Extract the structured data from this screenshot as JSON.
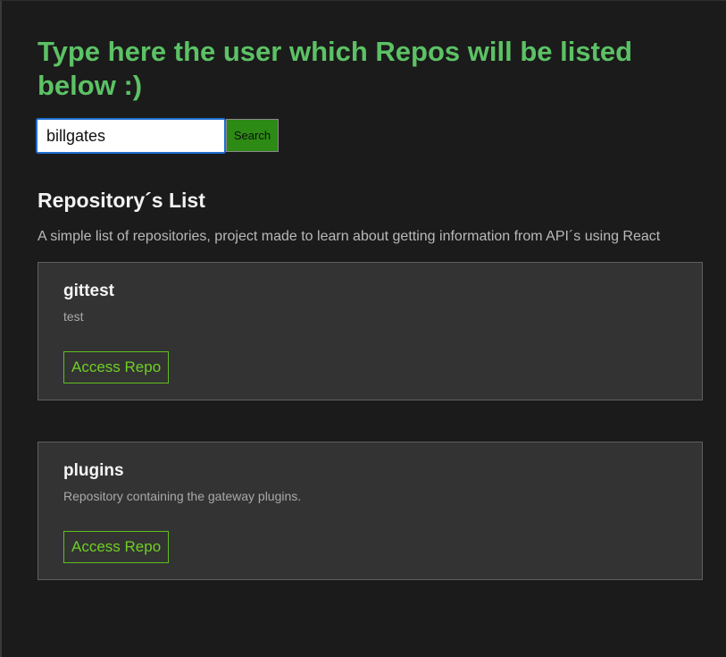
{
  "header": {
    "title": "Type here the user which Repos will be listed below :)"
  },
  "search": {
    "value": "billgates",
    "button_label": "Search"
  },
  "list": {
    "heading": "Repository´s List",
    "subtitle": "A simple list of repositories, project made to learn about getting information from API´s using React"
  },
  "repos": [
    {
      "name": "gittest",
      "description": "test",
      "link_label": "Access Repo"
    },
    {
      "name": "plugins",
      "description": "Repository containing the gateway plugins.",
      "link_label": "Access Repo"
    }
  ],
  "colors": {
    "background": "#1b1b1b",
    "title_green": "#5cc265",
    "button_green": "#2c8a15",
    "link_green": "#6fcf25",
    "card_bg": "#333333",
    "input_focus_border": "#1f6fd1"
  }
}
